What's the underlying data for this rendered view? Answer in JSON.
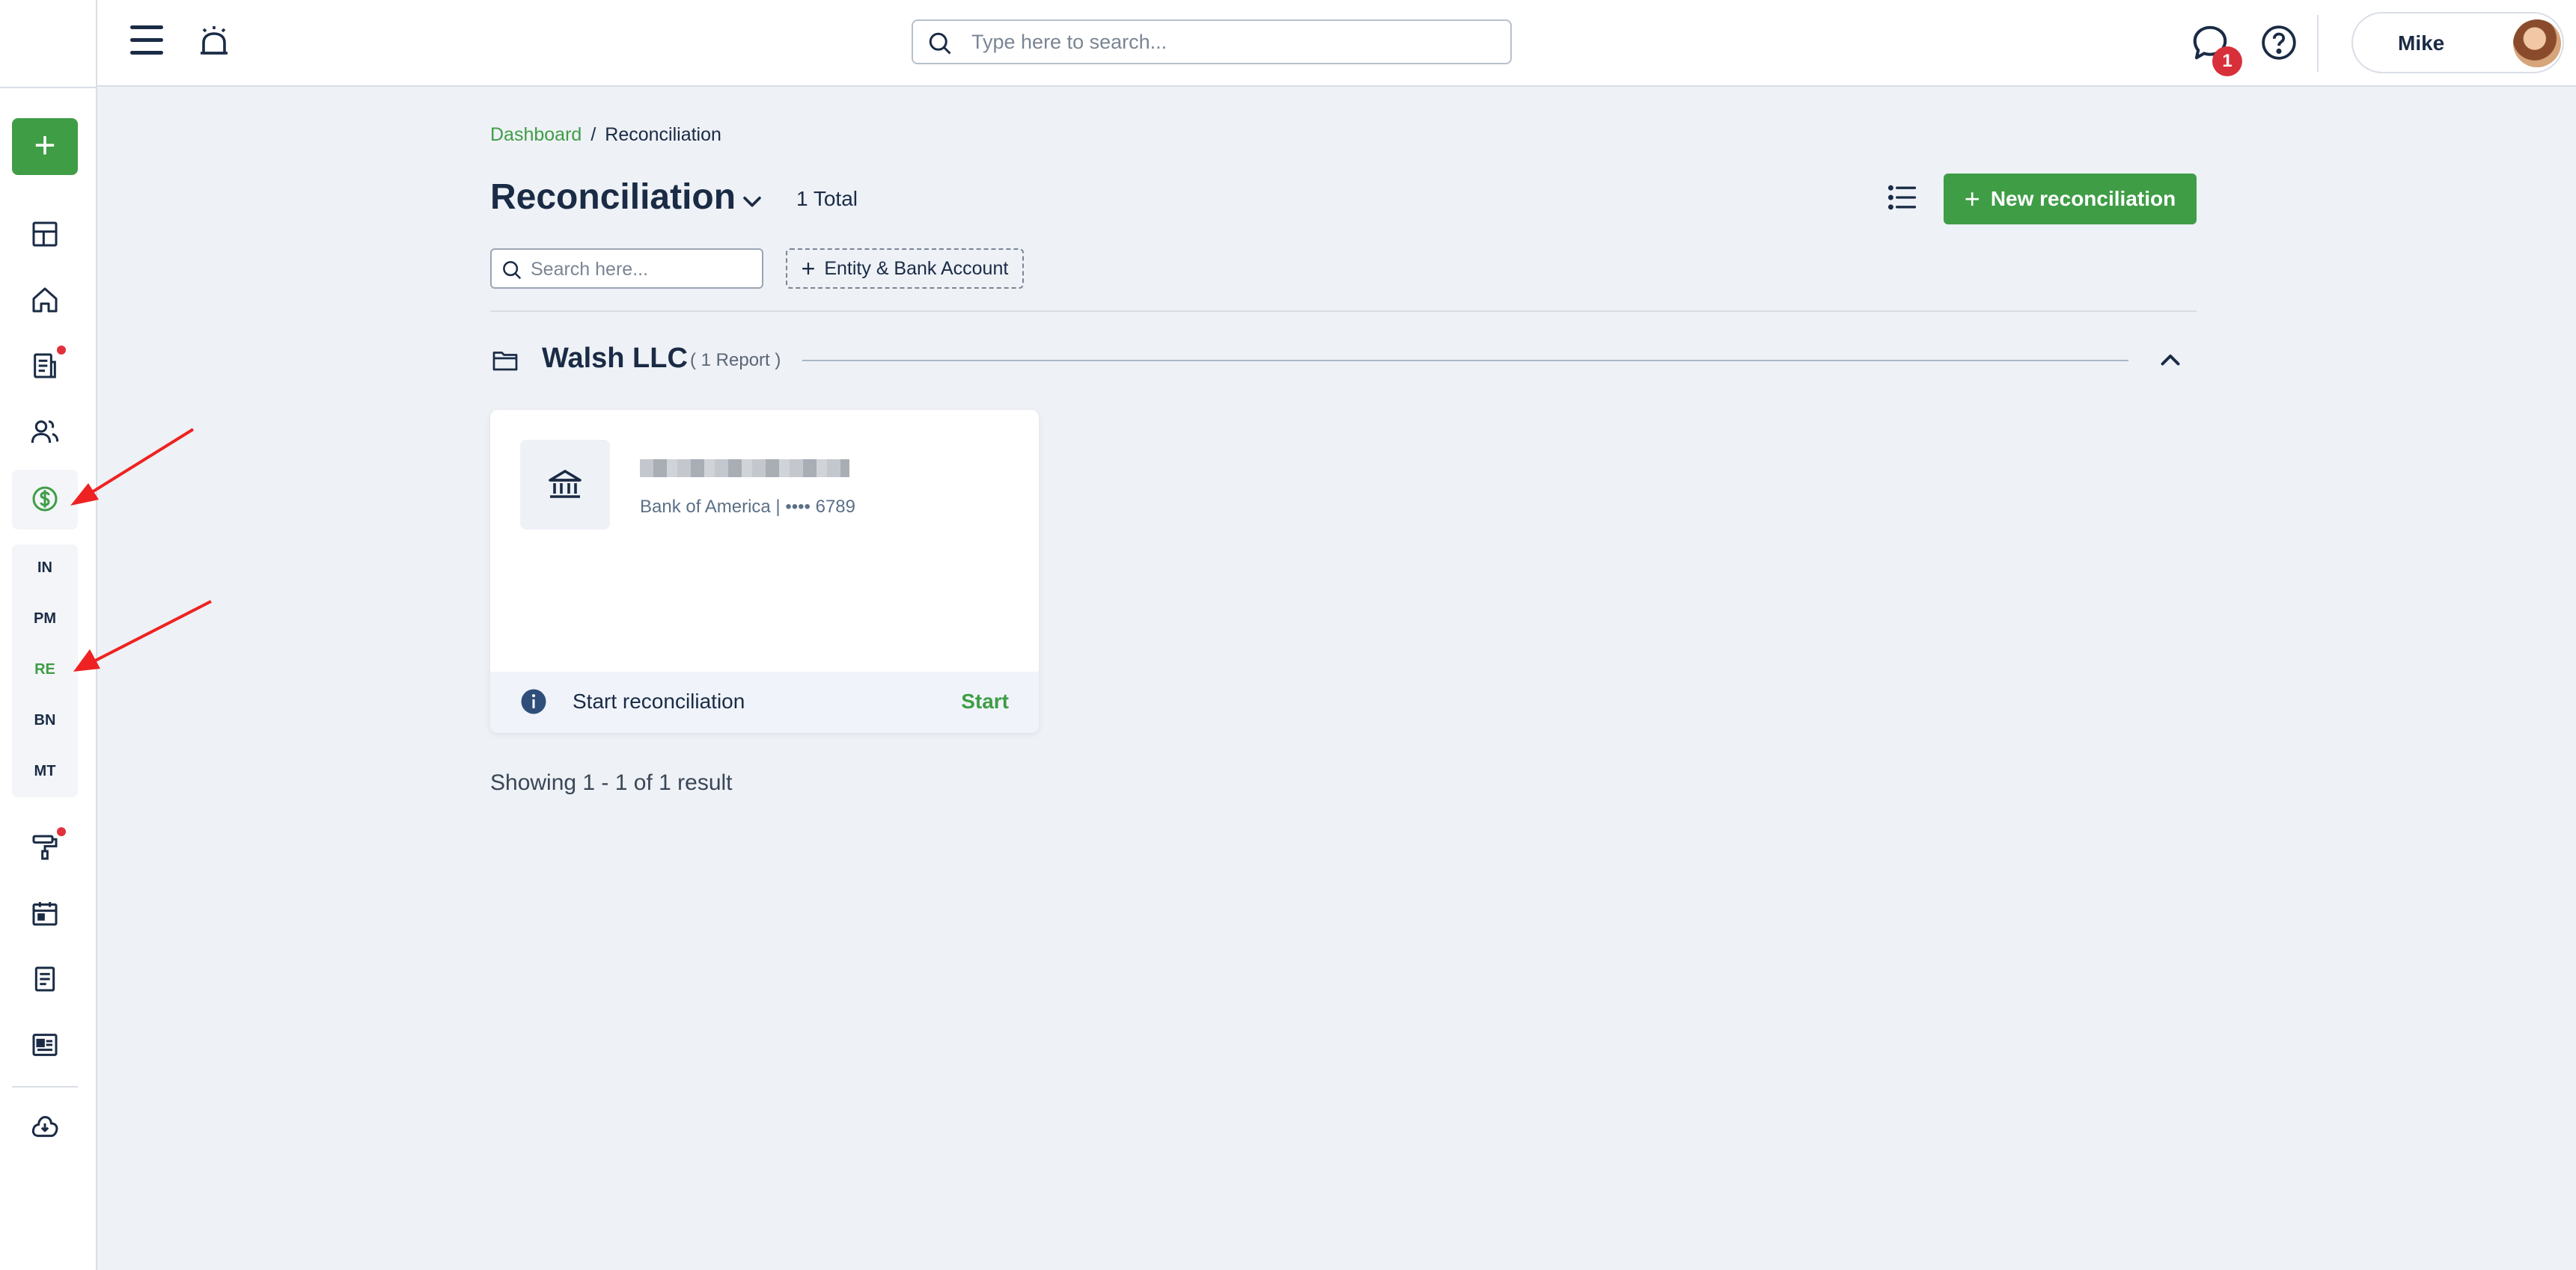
{
  "topbar": {
    "search_placeholder": "Type here to search...",
    "notification_count": "1",
    "user_name": "Mike"
  },
  "sidebar": {
    "add_label": "+",
    "sub_items": [
      "IN",
      "PM",
      "RE",
      "BN",
      "MT"
    ],
    "active_sub_item": "RE"
  },
  "breadcrumb": {
    "root": "Dashboard",
    "separator": "/",
    "current": "Reconciliation"
  },
  "header": {
    "title": "Reconciliation",
    "total": "1 Total",
    "new_button": "New reconciliation",
    "new_button_plus": "+"
  },
  "filters": {
    "search_placeholder": "Search here...",
    "entity_button": "Entity & Bank Account",
    "entity_plus": "+"
  },
  "group": {
    "name": "Walsh LLC",
    "count": "( 1 Report )"
  },
  "card": {
    "bank_info": "Bank of America | •••• 6789",
    "footer_text": "Start reconciliation",
    "start_label": "Start"
  },
  "pagination": {
    "showing": "Showing 1 - 1 of 1 result"
  },
  "colors": {
    "accent": "#3f9d46",
    "badge": "#d8303b",
    "text": "#1a2b45",
    "annotation_arrow": "#ee2222"
  }
}
